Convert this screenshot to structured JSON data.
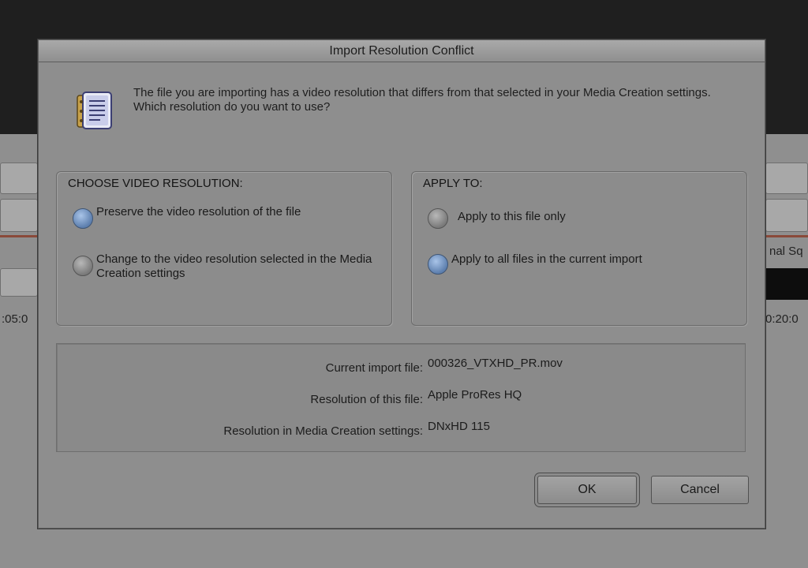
{
  "background_app": {
    "fragments": [
      ":05:0",
      "nal Sq",
      "0:20:0"
    ]
  },
  "dialog": {
    "title": "Import Resolution Conflict",
    "icon": "media-file-icon",
    "message": "The file you are importing has a video resolution that differs from that selected in your Media Creation settings.  Which resolution do you want to use?",
    "resolution_group": {
      "title": "CHOOSE VIDEO RESOLUTION:",
      "options": [
        {
          "label": "Preserve the video resolution of the file",
          "selected": true
        },
        {
          "label": "Change to the video resolution selected in the Media Creation settings",
          "selected": false
        }
      ]
    },
    "apply_group": {
      "title": "APPLY TO:",
      "options": [
        {
          "label": "Apply to this file only",
          "selected": false
        },
        {
          "label": "Apply to all files in the current import",
          "selected": true
        }
      ]
    },
    "info": {
      "current_file_label": "Current import file:",
      "current_file_value": "000326_VTXHD_PR.mov",
      "file_res_label": "Resolution of this file:",
      "file_res_value": "Apple ProRes HQ",
      "settings_res_label": "Resolution in Media Creation settings:",
      "settings_res_value": "DNxHD 115"
    },
    "buttons": {
      "ok": "OK",
      "cancel": "Cancel"
    }
  },
  "colors": {
    "dialog_bg": "#8e8e8e",
    "radio_selected": "#5d7fae",
    "background_dark": "#1f1f1f"
  }
}
